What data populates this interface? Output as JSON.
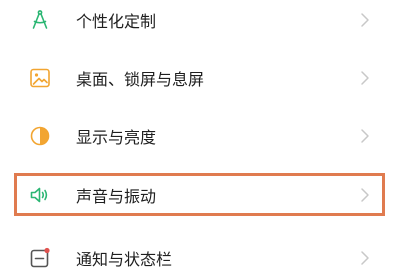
{
  "settings_list": {
    "items": [
      {
        "label": "个性化定制",
        "icon": "compass-icon",
        "icon_color": "#2bb673"
      },
      {
        "label": "桌面、锁屏与息屏",
        "icon": "wallpaper-icon",
        "icon_color": "#f2a531"
      },
      {
        "label": "显示与亮度",
        "icon": "brightness-icon",
        "icon_color": "#f2a531"
      },
      {
        "label": "声音与振动",
        "icon": "speaker-icon",
        "icon_color": "#2bb673"
      },
      {
        "label": "通知与状态栏",
        "icon": "notification-icon",
        "icon_color": "#e0524f"
      }
    ]
  },
  "highlight": {
    "target": "声音与振动",
    "color": "#e07b4f"
  },
  "colors": {
    "chevron": "#c8c8c8",
    "text": "#1f1f1f"
  }
}
